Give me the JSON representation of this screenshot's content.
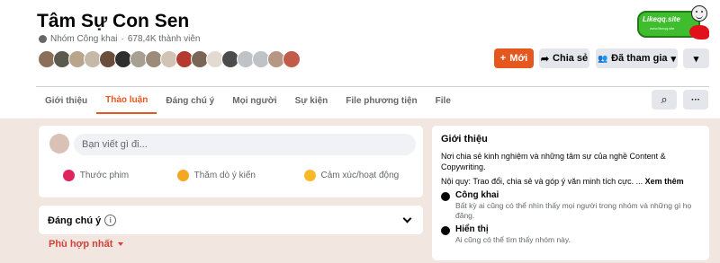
{
  "group": {
    "name": "Tâm Sự Con Sen",
    "privacy": "Nhóm Công khai",
    "members": "678,4K thành viên",
    "separator": "·"
  },
  "logo": {
    "text": "Likeqq.site",
    "sub": "www.likeqq.site"
  },
  "buttons": {
    "new": "Mới",
    "new_icon": "+",
    "share": "Chia sẻ",
    "share_icon": "➦",
    "joined": "Đã tham gia",
    "joined_icon": "👥",
    "dropdown_icon": "▾"
  },
  "tabs": [
    "Giới thiệu",
    "Thảo luận",
    "Đáng chú ý",
    "Mọi người",
    "Sự kiện",
    "File phương tiện",
    "File"
  ],
  "tab_actions": {
    "search_icon": "⌕",
    "more_icon": "···"
  },
  "composer": {
    "placeholder": "Bạn viết gì đi...",
    "actions": [
      {
        "label": "Thước phim",
        "color": "#e0245e"
      },
      {
        "label": "Thăm dò ý kiến",
        "color": "#f5a623"
      },
      {
        "label": "Cảm xúc/hoạt động",
        "color": "#f7b928"
      }
    ]
  },
  "featured": {
    "title": "Đáng chú ý",
    "info_icon": "i"
  },
  "sort": {
    "label": "Phù hợp nhất"
  },
  "about": {
    "title": "Giới thiệu",
    "description": "Nơi chia sẻ kinh nghiệm và những tâm sự của nghề Content & Copywriting.",
    "rules_prefix": "Nội quy: Trao đổi, chia sẻ và góp ý văn minh tích cực. ...",
    "see_more": "Xem thêm",
    "items": [
      {
        "title": "Công khai",
        "text": "Bất kỳ ai cũng có thể nhìn thấy mọi người trong nhóm và những gì họ đăng."
      },
      {
        "title": "Hiển thị",
        "text": "Ai cũng có thể tìm thấy nhóm này."
      }
    ]
  },
  "avatar_colors": [
    "#8a6f5a",
    "#5c5a4f",
    "#b8a58c",
    "#c7b9a8",
    "#6a4d3a",
    "#2f2f2f",
    "#a89f94",
    "#9c8b79",
    "#d1c4b4",
    "#b43b2f",
    "#7a6656",
    "#e3dbd2",
    "#4c4c4c",
    "#bfc3c8",
    "#bfc3c8",
    "#b79683",
    "#c15b4a"
  ]
}
